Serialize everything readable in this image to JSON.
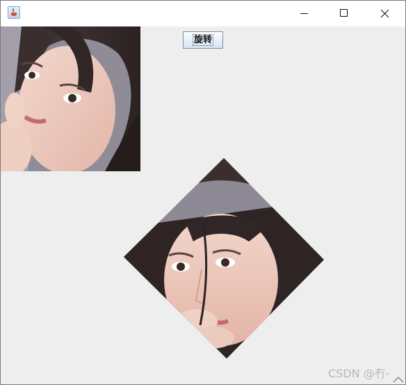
{
  "window": {
    "title": "",
    "app_icon": "java-cup-icon",
    "controls": {
      "minimize_icon": "minimize-icon",
      "maximize_icon": "maximize-icon",
      "close_icon": "close-icon"
    }
  },
  "toolbar": {
    "rotate_label": "旋转"
  },
  "canvas": {
    "original_image": "portrait-photo",
    "rotated_image": "portrait-photo-rotated-45deg",
    "rotation_degrees": 45
  },
  "watermark": {
    "text": "CSDN @冇-"
  },
  "colors": {
    "window_bg": "#eeeeee",
    "titlebar_bg": "#ffffff",
    "button_border": "#7a8ea8",
    "watermark": "#b8b8b8"
  }
}
